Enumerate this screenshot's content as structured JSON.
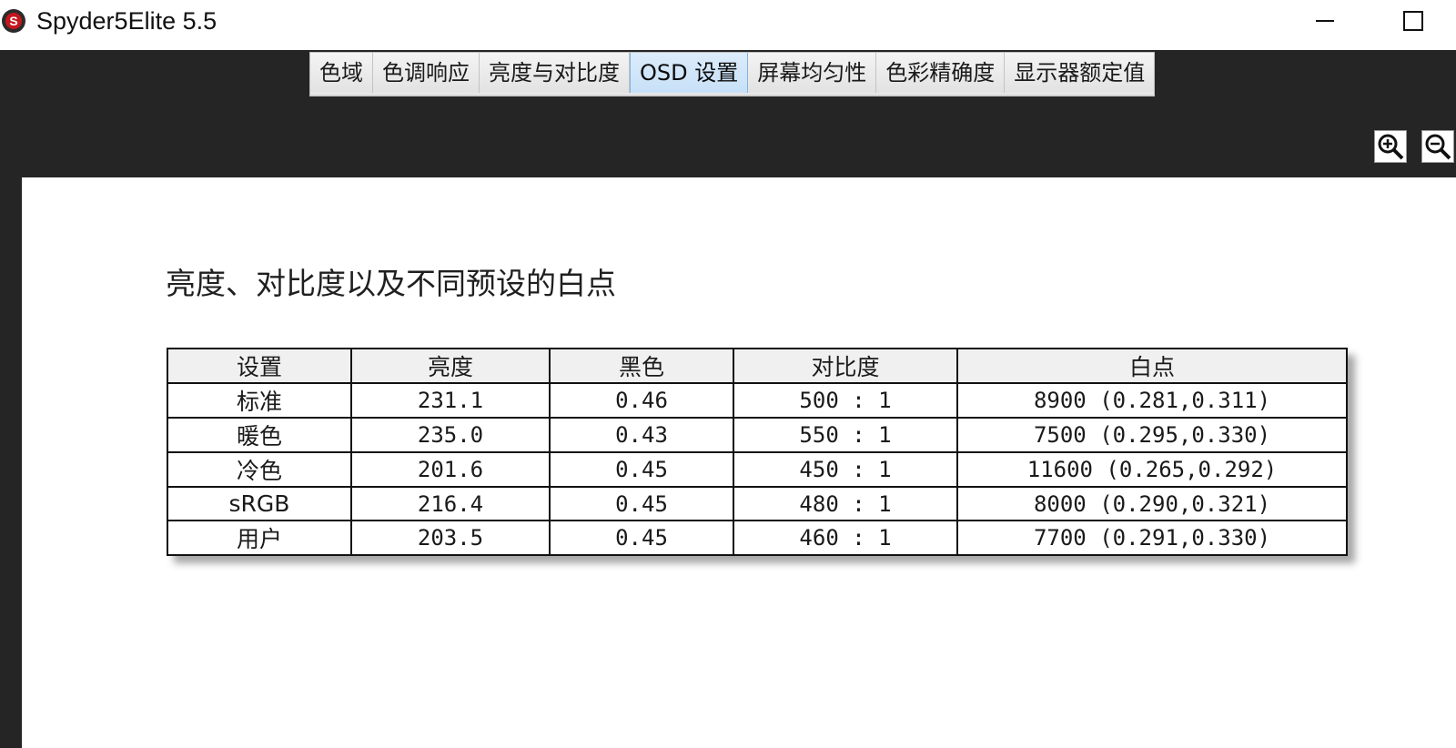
{
  "window": {
    "title": "Spyder5Elite 5.5"
  },
  "tabs": [
    {
      "label": "色域",
      "active": false
    },
    {
      "label": "色调响应",
      "active": false
    },
    {
      "label": "亮度与对比度",
      "active": false
    },
    {
      "label": "OSD 设置",
      "active": true
    },
    {
      "label": "屏幕均匀性",
      "active": false
    },
    {
      "label": "色彩精确度",
      "active": false
    },
    {
      "label": "显示器额定值",
      "active": false
    }
  ],
  "toolbar": {
    "zoom_in_icon": "zoom-in-icon",
    "zoom_out_icon": "zoom-out-icon"
  },
  "report": {
    "title": "亮度、对比度以及不同预设的白点",
    "columns": [
      "设置",
      "亮度",
      "黑色",
      "对比度",
      "白点"
    ],
    "rows": [
      {
        "setting": "标准",
        "brightness": "231.1",
        "black": "0.46",
        "contrast": "500 : 1",
        "whitepoint": "8900 (0.281,0.311)"
      },
      {
        "setting": "暖色",
        "brightness": "235.0",
        "black": "0.43",
        "contrast": "550 : 1",
        "whitepoint": "7500 (0.295,0.330)"
      },
      {
        "setting": "冷色",
        "brightness": "201.6",
        "black": "0.45",
        "contrast": "450 : 1",
        "whitepoint": "11600 (0.265,0.292)"
      },
      {
        "setting": "sRGB",
        "brightness": "216.4",
        "black": "0.45",
        "contrast": "480 : 1",
        "whitepoint": "8000 (0.290,0.321)"
      },
      {
        "setting": "用户",
        "brightness": "203.5",
        "black": "0.45",
        "contrast": "460 : 1",
        "whitepoint": "7700 (0.291,0.330)"
      }
    ]
  },
  "colors": {
    "dark_chrome": "#252525",
    "active_tab": "#c7e0f7",
    "table_header": "#f0f0f0"
  }
}
